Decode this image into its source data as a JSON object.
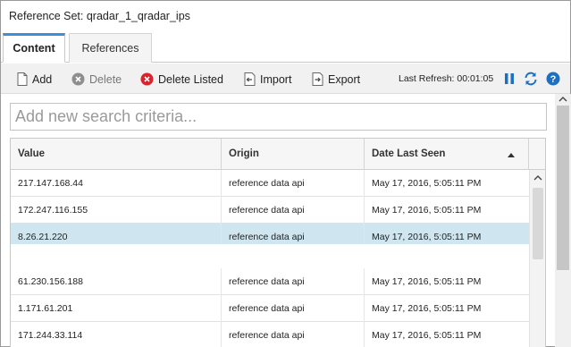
{
  "window": {
    "title": "Reference Set: qradar_1_qradar_ips"
  },
  "tabs": [
    {
      "label": "Content",
      "active": true
    },
    {
      "label": "References",
      "active": false
    }
  ],
  "toolbar": {
    "add_label": "Add",
    "delete_label": "Delete",
    "delete_listed_label": "Delete Listed",
    "import_label": "Import",
    "export_label": "Export",
    "last_refresh": "Last Refresh: 00:01:05",
    "icons": [
      "pause-icon",
      "refresh-icon",
      "help-icon"
    ]
  },
  "search": {
    "placeholder": "Add new search criteria..."
  },
  "grid": {
    "columns": [
      "Value",
      "Origin",
      "Date Last Seen"
    ],
    "sort": {
      "column": "Date Last Seen",
      "direction": "ascending"
    },
    "rows": [
      {
        "value": "217.147.168.44",
        "origin": "reference data api",
        "date": "May 17, 2016, 5:05:11 PM",
        "selected": false
      },
      {
        "value": "172.247.116.155",
        "origin": "reference data api",
        "date": "May 17, 2016, 5:05:11 PM",
        "selected": false
      },
      {
        "value": "8.26.21.220",
        "origin": "reference data api",
        "date": "May 17, 2016, 5:05:11 PM",
        "selected": true
      },
      {
        "value": "61.230.156.188",
        "origin": "reference data api",
        "date": "May 17, 2016, 5:05:11 PM",
        "selected": false
      },
      {
        "value": "1.171.61.201",
        "origin": "reference data api",
        "date": "May 17, 2016, 5:05:11 PM",
        "selected": false
      },
      {
        "value": "171.244.33.114",
        "origin": "reference data api",
        "date": "May 17, 2016, 5:05:11 PM",
        "selected": false
      }
    ]
  },
  "colors": {
    "accent": "#3a8fd9",
    "selected_row": "#cfe6f1",
    "toolbar_bg": "#f1f1f1",
    "delete_listed_icon": "#d9232e",
    "pause_icon": "#1f6fc0"
  }
}
